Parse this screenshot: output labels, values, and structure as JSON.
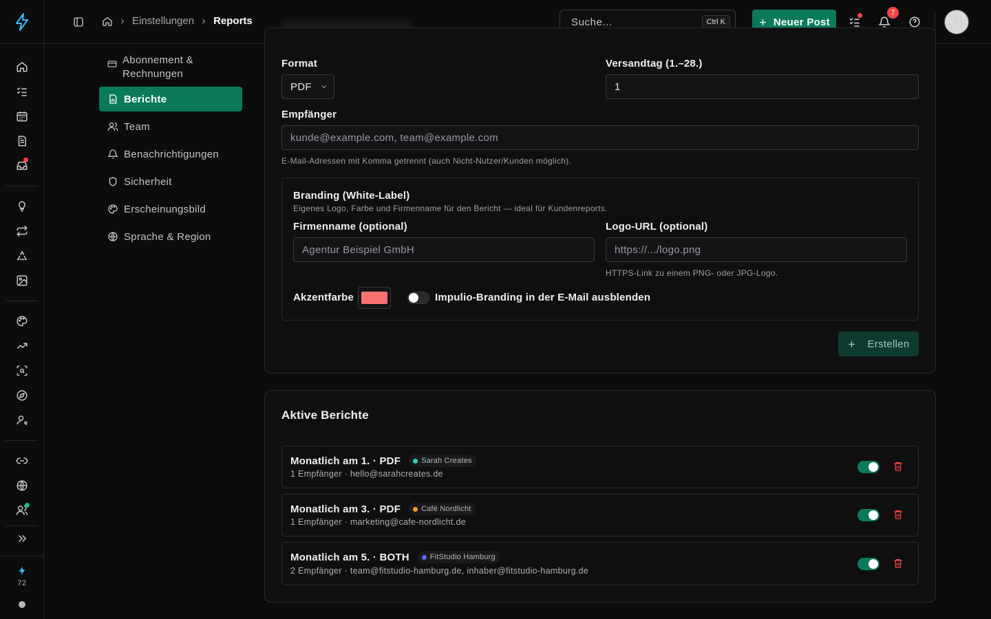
{
  "topbar": {
    "breadcrumb": [
      "Einstellungen",
      "Reports"
    ],
    "search_placeholder": "Suche...",
    "search_shortcut": "Ctrl K",
    "new_post_label": "Neuer Post",
    "notification_count": "7"
  },
  "sidebar": {
    "credits": "72"
  },
  "settings_nav": {
    "items": [
      {
        "label": "Abonnement & Rechnungen",
        "icon": "credit-card-icon"
      },
      {
        "label": "Berichte",
        "icon": "report-icon",
        "active": true
      },
      {
        "label": "Team",
        "icon": "users-icon"
      },
      {
        "label": "Benachrichtigungen",
        "icon": "bell-icon"
      },
      {
        "label": "Sicherheit",
        "icon": "shield-icon"
      },
      {
        "label": "Erscheinungsbild",
        "icon": "palette-icon"
      },
      {
        "label": "Sprache & Region",
        "icon": "globe-icon"
      }
    ]
  },
  "form": {
    "format_label": "Format",
    "format_value": "PDF",
    "send_day_label": "Versandtag (1.–28.)",
    "send_day_value": "1",
    "recipients_label": "Empfänger",
    "recipients_placeholder": "kunde@example.com, team@example.com",
    "recipients_help": "E-Mail-Adressen mit Komma getrennt (auch Nicht-Nutzer/Kunden möglich).",
    "branding": {
      "title": "Branding (White-Label)",
      "subtitle": "Eigenes Logo, Farbe und Firmenname für den Bericht — ideal für Kundenreports.",
      "company_label": "Firmenname (optional)",
      "company_placeholder": "Agentur Beispiel GmbH",
      "logo_label": "Logo-URL (optional)",
      "logo_placeholder": "https://.../logo.png",
      "logo_help": "HTTPS-Link zu einem PNG- oder JPG-Logo.",
      "accent_label": "Akzentfarbe",
      "accent_color": "#f87171",
      "hide_branding_label": "Impulio-Branding in der E-Mail ausblenden",
      "hide_branding_on": false
    },
    "create_label": "Erstellen"
  },
  "active_reports": {
    "title": "Aktive Berichte",
    "rows": [
      {
        "title": "Monatlich am 1. · PDF",
        "client": "Sarah Creates",
        "client_color": "#2dd4bf",
        "sub": "1 Empfänger · hello@sarahcreates.de",
        "enabled": true
      },
      {
        "title": "Monatlich am 3. · PDF",
        "client": "Café Nordlicht",
        "client_color": "#f59e0b",
        "sub": "1 Empfänger · marketing@cafe-nordlicht.de",
        "enabled": true
      },
      {
        "title": "Monatlich am 5. · BOTH",
        "client": "FitStudio Hamburg",
        "client_color": "#6366f1",
        "sub": "2 Empfänger · team@fitstudio-hamburg.de, inhaber@fitstudio-hamburg.de",
        "enabled": true
      }
    ]
  },
  "colors": {
    "primary": "#0b7a5b",
    "danger": "#ef4444"
  }
}
